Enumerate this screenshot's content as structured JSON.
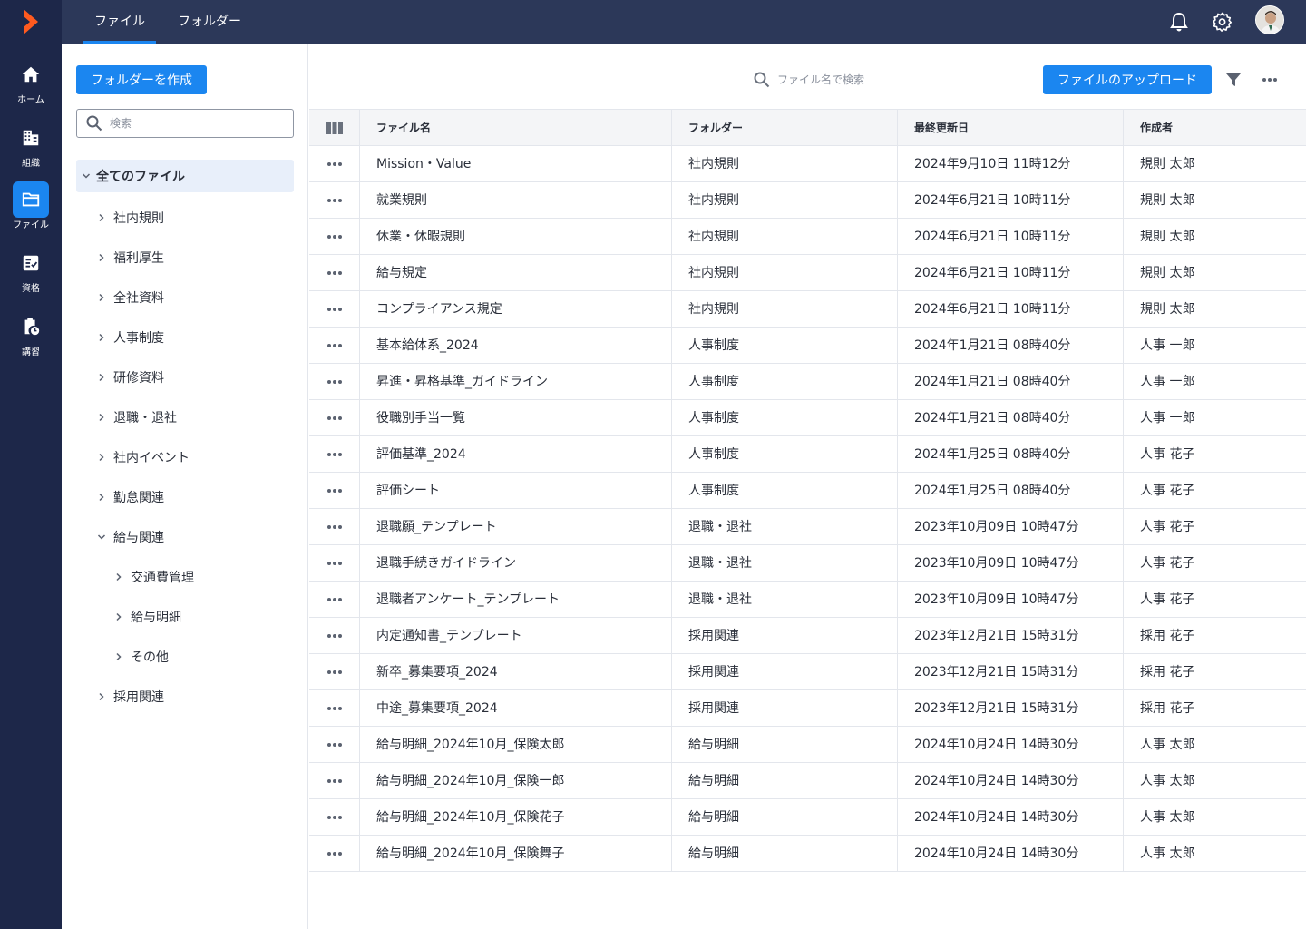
{
  "rail": {
    "items": [
      {
        "icon": "home-icon",
        "label": "ホーム",
        "active": false
      },
      {
        "icon": "organization-icon",
        "label": "組織",
        "active": false
      },
      {
        "icon": "folder-icon",
        "label": "ファイル",
        "active": true
      },
      {
        "icon": "certificate-icon",
        "label": "資格",
        "active": false
      },
      {
        "icon": "clipboard-clock-icon",
        "label": "講習",
        "active": false
      }
    ]
  },
  "topbar": {
    "tabs": [
      {
        "label": "ファイル",
        "active": true
      },
      {
        "label": "フォルダー",
        "active": false
      }
    ],
    "icons": [
      "bell-icon",
      "gear-icon"
    ]
  },
  "folder_panel": {
    "create_button": "フォルダーを作成",
    "search_placeholder": "検索",
    "all_files": "全てのファイル",
    "folders": [
      {
        "label": "社内規則",
        "level": 1,
        "expanded": false
      },
      {
        "label": "福利厚生",
        "level": 1,
        "expanded": false
      },
      {
        "label": "全社資料",
        "level": 1,
        "expanded": false
      },
      {
        "label": "人事制度",
        "level": 1,
        "expanded": false
      },
      {
        "label": "研修資料",
        "level": 1,
        "expanded": false
      },
      {
        "label": "退職・退社",
        "level": 1,
        "expanded": false
      },
      {
        "label": "社内イベント",
        "level": 1,
        "expanded": false
      },
      {
        "label": "勤怠関連",
        "level": 1,
        "expanded": false
      },
      {
        "label": "給与関連",
        "level": 1,
        "expanded": true
      },
      {
        "label": "交通費管理",
        "level": 2,
        "expanded": false
      },
      {
        "label": "給与明細",
        "level": 2,
        "expanded": false
      },
      {
        "label": "その他",
        "level": 2,
        "expanded": false
      },
      {
        "label": "採用関連",
        "level": 1,
        "expanded": false
      }
    ]
  },
  "main": {
    "search_placeholder": "ファイル名で検索",
    "upload_button": "ファイルのアップロード",
    "columns": [
      "ファイル名",
      "フォルダー",
      "最終更新日",
      "作成者"
    ],
    "rows": [
      [
        "Mission・Value",
        "社内規則",
        "2024年9月10日 11時12分",
        "規則 太郎"
      ],
      [
        "就業規則",
        "社内規則",
        "2024年6月21日 10時11分",
        "規則 太郎"
      ],
      [
        "休業・休暇規則",
        "社内規則",
        "2024年6月21日 10時11分",
        "規則 太郎"
      ],
      [
        "給与規定",
        "社内規則",
        "2024年6月21日 10時11分",
        "規則 太郎"
      ],
      [
        "コンプライアンス規定",
        "社内規則",
        "2024年6月21日 10時11分",
        "規則 太郎"
      ],
      [
        "基本給体系_2024",
        "人事制度",
        "2024年1月21日 08時40分",
        "人事 一郎"
      ],
      [
        "昇進・昇格基準_ガイドライン",
        "人事制度",
        "2024年1月21日 08時40分",
        "人事 一郎"
      ],
      [
        "役職別手当一覧",
        "人事制度",
        "2024年1月21日 08時40分",
        "人事 一郎"
      ],
      [
        "評価基準_2024",
        "人事制度",
        "2024年1月25日 08時40分",
        "人事 花子"
      ],
      [
        "評価シート",
        "人事制度",
        "2024年1月25日 08時40分",
        "人事 花子"
      ],
      [
        "退職願_テンプレート",
        "退職・退社",
        "2023年10月09日 10時47分",
        "人事 花子"
      ],
      [
        "退職手続きガイドライン",
        "退職・退社",
        "2023年10月09日 10時47分",
        "人事 花子"
      ],
      [
        "退職者アンケート_テンプレート",
        "退職・退社",
        "2023年10月09日 10時47分",
        "人事 花子"
      ],
      [
        "内定通知書_テンプレート",
        "採用関連",
        "2023年12月21日 15時31分",
        "採用 花子"
      ],
      [
        "新卒_募集要項_2024",
        "採用関連",
        "2023年12月21日 15時31分",
        "採用 花子"
      ],
      [
        "中途_募集要項_2024",
        "採用関連",
        "2023年12月21日 15時31分",
        "採用 花子"
      ],
      [
        "給与明細_2024年10月_保険太郎",
        "給与明細",
        "2024年10月24日 14時30分",
        "人事 太郎"
      ],
      [
        "給与明細_2024年10月_保険一郎",
        "給与明細",
        "2024年10月24日 14時30分",
        "人事 太郎"
      ],
      [
        "給与明細_2024年10月_保険花子",
        "給与明細",
        "2024年10月24日 14時30分",
        "人事 太郎"
      ],
      [
        "給与明細_2024年10月_保険舞子",
        "給与明細",
        "2024年10月24日 14時30分",
        "人事 太郎"
      ]
    ]
  },
  "colors": {
    "rail_bg": "#1d2749",
    "topbar_bg": "#2c3859",
    "accent": "#1b86f0",
    "logo": "#ff5a1f"
  }
}
